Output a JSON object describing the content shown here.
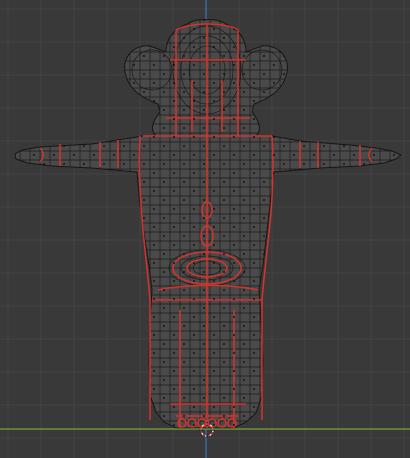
{
  "viewport": {
    "background_color": "#393939",
    "grid_color": "#444444",
    "x_axis_color": "#8cbb3a",
    "z_axis_color": "#3f7fd6",
    "icons": [
      "3d-cursor-icon"
    ]
  },
  "mesh": {
    "face_color": "#4a4a4a",
    "wire_color": "#161616",
    "seam_color": "#d4332c",
    "vertex_color": "#0b0b0b"
  }
}
